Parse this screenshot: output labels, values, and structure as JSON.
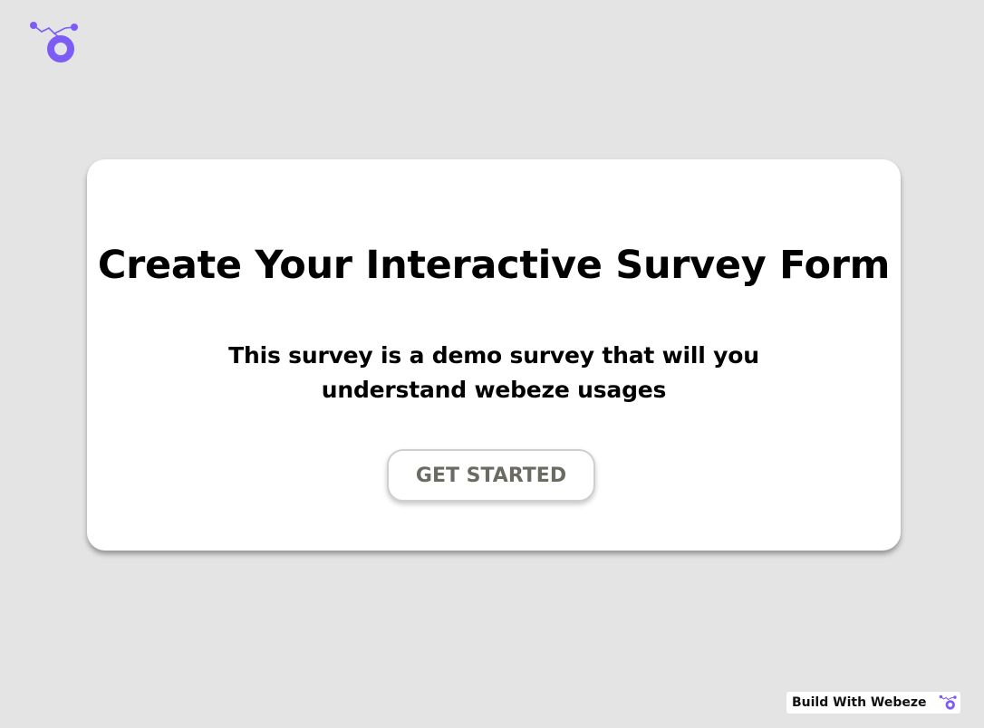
{
  "brand": {
    "logo_icon": "webeze-logo-icon",
    "accent_color": "#7c5cf5"
  },
  "card": {
    "title": "Create Your Interactive Survey Form",
    "subtitle": "This survey is a demo survey that will you understand webeze usages",
    "cta_label": "GET STARTED"
  },
  "footer_badge": {
    "label": "Build With Webeze",
    "icon": "webeze-logo-icon"
  }
}
